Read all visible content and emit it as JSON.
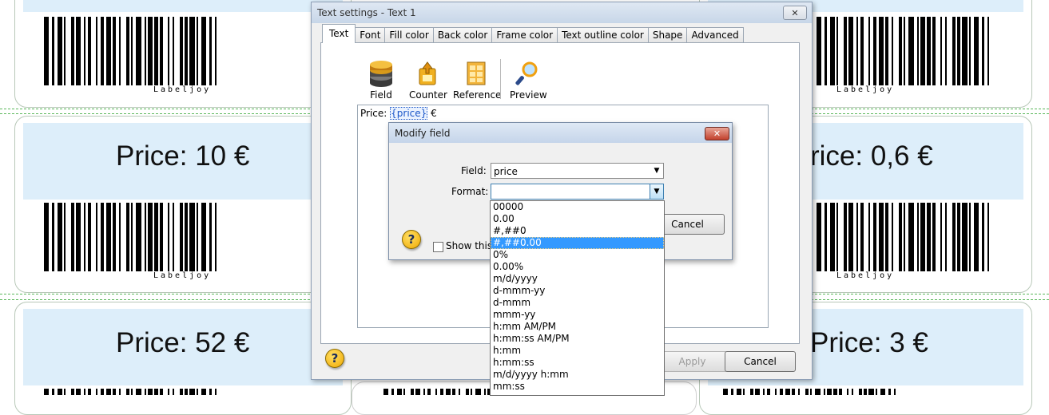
{
  "labels": {
    "prices": [
      "Price: 10 €",
      "Price: 52 €",
      "rice: 0,6 €",
      "Price: 3 €"
    ],
    "brand": "Labeljoy"
  },
  "dialog": {
    "title": "Text settings - Text 1",
    "tabs": [
      "Text",
      "Font",
      "Fill color",
      "Back color",
      "Frame color",
      "Text outline color",
      "Shape",
      "Advanced"
    ],
    "active_tab": "Text",
    "toolbar": [
      "Field",
      "Counter",
      "Reference",
      "Preview"
    ],
    "editor_prefix": "Price: ",
    "editor_field": "{price}",
    "editor_suffix": " €",
    "apply_label": "Apply",
    "cancel_label": "Cancel"
  },
  "modify_field": {
    "title": "Modify field",
    "field_label": "Field:",
    "field_value": "price",
    "format_label": "Format:",
    "format_value": "",
    "cancel_label": "Cancel",
    "checkbox_label": "Show this f",
    "format_options": [
      "00000",
      "0.00",
      "#,##0",
      "#,##0.00",
      "0%",
      "0.00%",
      "m/d/yyyy",
      "d-mmm-yy",
      "d-mmm",
      "mmm-yy",
      "h:mm AM/PM",
      "h:mm:ss AM/PM",
      "h:mm",
      "h:mm:ss",
      "m/d/yyyy h:mm",
      "mm:ss"
    ],
    "selected_option": "#,##0.00"
  },
  "colors": {
    "label_band": "#ddeefa",
    "selection": "#3399ff",
    "guide_line": "#5cb85c"
  }
}
